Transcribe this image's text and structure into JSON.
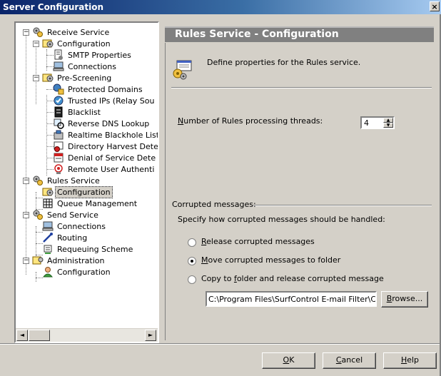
{
  "window": {
    "title": "Server Configuration",
    "close_label": "×"
  },
  "tree": {
    "items": [
      {
        "label": "Receive Service",
        "level": 0,
        "icon": "service-gear-icon",
        "expander": "−"
      },
      {
        "label": "Configuration",
        "level": 1,
        "icon": "config-gear-icon",
        "expander": "−"
      },
      {
        "label": "SMTP Properties",
        "level": 2,
        "icon": "smtp-properties-icon"
      },
      {
        "label": "Connections",
        "level": 2,
        "icon": "computer-icon"
      },
      {
        "label": "Pre-Screening",
        "level": 1,
        "icon": "config-gear-icon",
        "expander": "−"
      },
      {
        "label": "Protected Domains",
        "level": 2,
        "icon": "protected-domains-icon"
      },
      {
        "label": "Trusted IPs (Relay Sou",
        "level": 2,
        "icon": "trusted-ips-icon"
      },
      {
        "label": "Blacklist",
        "level": 2,
        "icon": "blacklist-icon"
      },
      {
        "label": "Reverse DNS Lookup",
        "level": 2,
        "icon": "reverse-dns-icon"
      },
      {
        "label": "Realtime Blackhole List",
        "level": 2,
        "icon": "blackhole-list-icon"
      },
      {
        "label": "Directory Harvest Dete",
        "level": 2,
        "icon": "directory-harvest-icon"
      },
      {
        "label": "Denial of Service Dete",
        "level": 2,
        "icon": "denial-of-service-icon"
      },
      {
        "label": "Remote User Authenti",
        "level": 2,
        "icon": "remote-user-icon"
      },
      {
        "label": "Rules Service",
        "level": 0,
        "icon": "service-gear-icon",
        "expander": "−"
      },
      {
        "label": "Configuration",
        "level": 1,
        "icon": "config-gear-icon",
        "selected": true
      },
      {
        "label": "Queue Management",
        "level": 1,
        "icon": "queue-grid-icon"
      },
      {
        "label": "Send Service",
        "level": 0,
        "icon": "service-gear-icon",
        "expander": "−"
      },
      {
        "label": "Connections",
        "level": 1,
        "icon": "computer-icon"
      },
      {
        "label": "Routing",
        "level": 1,
        "icon": "routing-icon"
      },
      {
        "label": "Requeuing Scheme",
        "level": 1,
        "icon": "requeuing-icon"
      },
      {
        "label": "Administration",
        "level": 0,
        "icon": "administration-icon",
        "expander": "−"
      },
      {
        "label": "Configuration",
        "level": 1,
        "icon": "user-config-icon"
      }
    ],
    "scroll_left": "◄",
    "scroll_right": "►"
  },
  "panel": {
    "title": "Rules Service - Configuration",
    "description": "Define properties for the Rules service.",
    "threads_label_accel": "N",
    "threads_label_rest": "umber of Rules processing threads:",
    "threads_value": "4",
    "spin_up": "▲",
    "spin_down": "▼",
    "corrupted_group_label": "Corrupted messages:",
    "corrupted_instruction": "Specify how corrupted messages should be handled:",
    "options": [
      {
        "accel": "R",
        "rest": "elease corrupted messages",
        "selected": false
      },
      {
        "accel": "M",
        "rest": "ove corrupted messages to folder",
        "selected": true
      },
      {
        "pre": "Copy to ",
        "accel": "f",
        "rest": "older and release corrupted message",
        "selected": false
      }
    ],
    "folder_path": "C:\\Program Files\\SurfControl E-mail Filter\\Corr",
    "browse_accel": "B",
    "browse_rest": "rowse..."
  },
  "buttons": {
    "ok_accel": "O",
    "ok_rest": "K",
    "cancel_accel": "C",
    "cancel_rest": "ancel",
    "help_accel": "H",
    "help_rest": "elp"
  }
}
